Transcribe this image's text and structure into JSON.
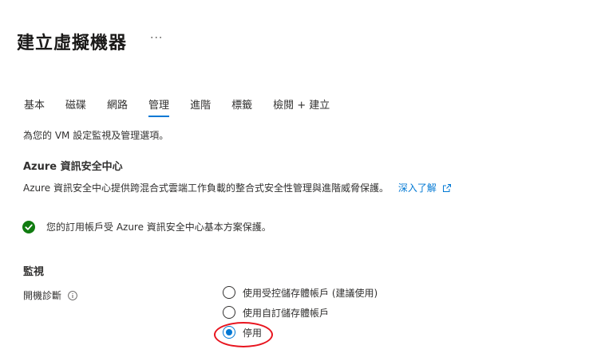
{
  "header": {
    "title": "建立虛擬機器",
    "more_label": "···"
  },
  "tabs": [
    {
      "label": "基本",
      "active": false
    },
    {
      "label": "磁碟",
      "active": false
    },
    {
      "label": "網路",
      "active": false
    },
    {
      "label": "管理",
      "active": true
    },
    {
      "label": "進階",
      "active": false
    },
    {
      "label": "標籤",
      "active": false
    },
    {
      "label": "檢閱 + 建立",
      "active": false
    }
  ],
  "description": "為您的 VM 設定監視及管理選項。",
  "azure_security": {
    "title": "Azure 資訊安全中心",
    "description": "Azure 資訊安全中心提供跨混合式雲端工作負載的整合式安全性管理與進階威脅保護。",
    "learn_more": "深入了解",
    "status_text": "您的訂用帳戶受 Azure 資訊安全中心基本方案保護。",
    "status_icon": "check-circle-icon",
    "status_color": "#107c10"
  },
  "monitoring": {
    "title": "監視",
    "boot_diagnostics_label": "開機診斷",
    "options": [
      {
        "label": "使用受控儲存體帳戶 (建議使用)",
        "selected": false
      },
      {
        "label": "使用自訂儲存體帳戶",
        "selected": false
      },
      {
        "label": "停用",
        "selected": true
      }
    ]
  },
  "colors": {
    "accent": "#0078d4",
    "annotation": "#e8151f"
  }
}
